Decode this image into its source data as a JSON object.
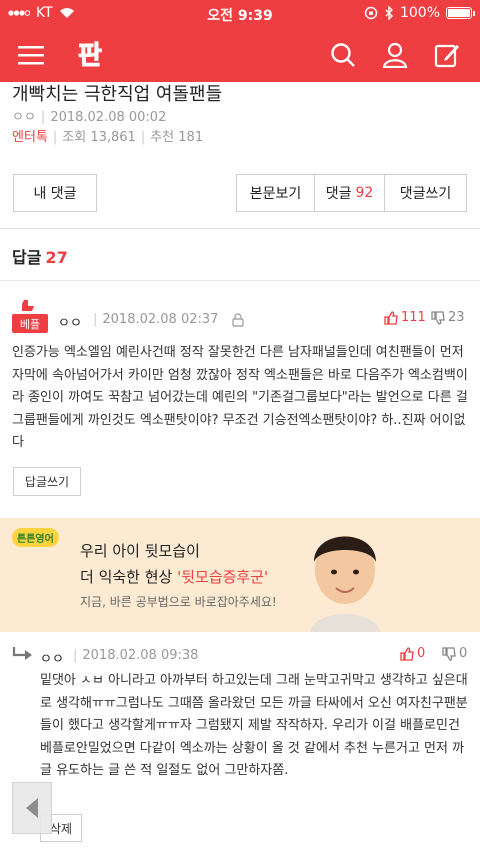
{
  "status_bar": {
    "carrier": "KT",
    "time": "오전 9:39",
    "battery": "100%"
  },
  "header": {
    "logo_text": "판",
    "icons": [
      "menu-icon",
      "search-icon",
      "user-icon",
      "write-icon"
    ]
  },
  "post": {
    "title": "개빡치는 극한직업 여돌팬들",
    "author": "ㅇㅇ",
    "date": "2018.02.08 00:02",
    "category": "엔터톡",
    "views": "조회 13,861",
    "recommends": "추천 181"
  },
  "actions": {
    "my_comments": "내 댓글",
    "view_body": "본문보기",
    "comments_label": "댓글",
    "comments_count": "92",
    "write_comment": "댓글쓰기"
  },
  "replies": {
    "label": "답글",
    "count": "27"
  },
  "comments": [
    {
      "badge": "베플",
      "author": "ㅇㅇ",
      "date": "2018.02.08 02:37",
      "up": "111",
      "down": "23",
      "body": "인증가능 엑소엘임 예린사건때 정작 잘못한건 다른 남자패널들인데 여친팬들이 먼저 자막에 속아넘어가서 카이만 엄청 깠잖아 정작 엑소팬들은 바로 다음주가 엑소컴백이라 종인이 까여도 꾹참고 넘어갔는데 예린의 \"기존걸그룹보다\"라는 발언으로 다른 걸그룹팬들에게 까인것도 엑소팬탓이야? 무조건 기승전엑소팬탓이야? 하..진짜 어이없다",
      "reply_button": "답글쓰기"
    },
    {
      "author": "ㅇㅇ",
      "date": "2018.02.08 09:38",
      "up": "0",
      "down": "0",
      "body": "밑댓아 ㅅㅂ 아니라고 아까부터 하고있는데 그래 눈막고귀막고 생각하고 싶은대로 생각해ㅠㅠ그럼나도 그때쯤 올라왔던 모든 까글 타싸에서 오신 여자친구팬분들이 했다고 생각할게ㅠㅠ자 그럼됐지 제발 작작하자. 우리가 이걸 배플로민건 베플로안밀었으면 다같이 엑소까는 상황이 올 것 같에서 추천 누른거고 먼저 까글 유도하는 글 쓴 적 일절도 없어 그만하자쫌.",
      "delete_button": "삭제"
    }
  ],
  "ad": {
    "brand": "튼튼영어",
    "line1": "우리 아이 뒷모습이",
    "line2_prefix": "더 익숙한 현상 ",
    "line2_highlight": "'뒷모습증후군'",
    "line3": "지금, 바른 공부법으로 바로잡아주세요!"
  },
  "colors": {
    "brand_red": "#ef3e42",
    "ad_bg": "#fcebd2"
  }
}
